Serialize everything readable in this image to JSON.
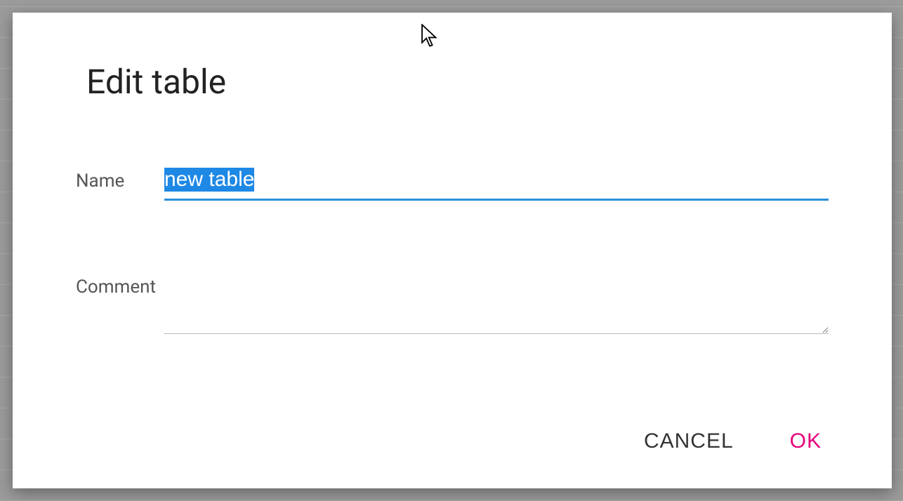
{
  "dialog": {
    "title": "Edit table",
    "nameLabel": "Name",
    "nameValue": "new table",
    "commentLabel": "Comment",
    "commentValue": "",
    "cancelLabel": "CANCEL",
    "okLabel": "OK"
  }
}
